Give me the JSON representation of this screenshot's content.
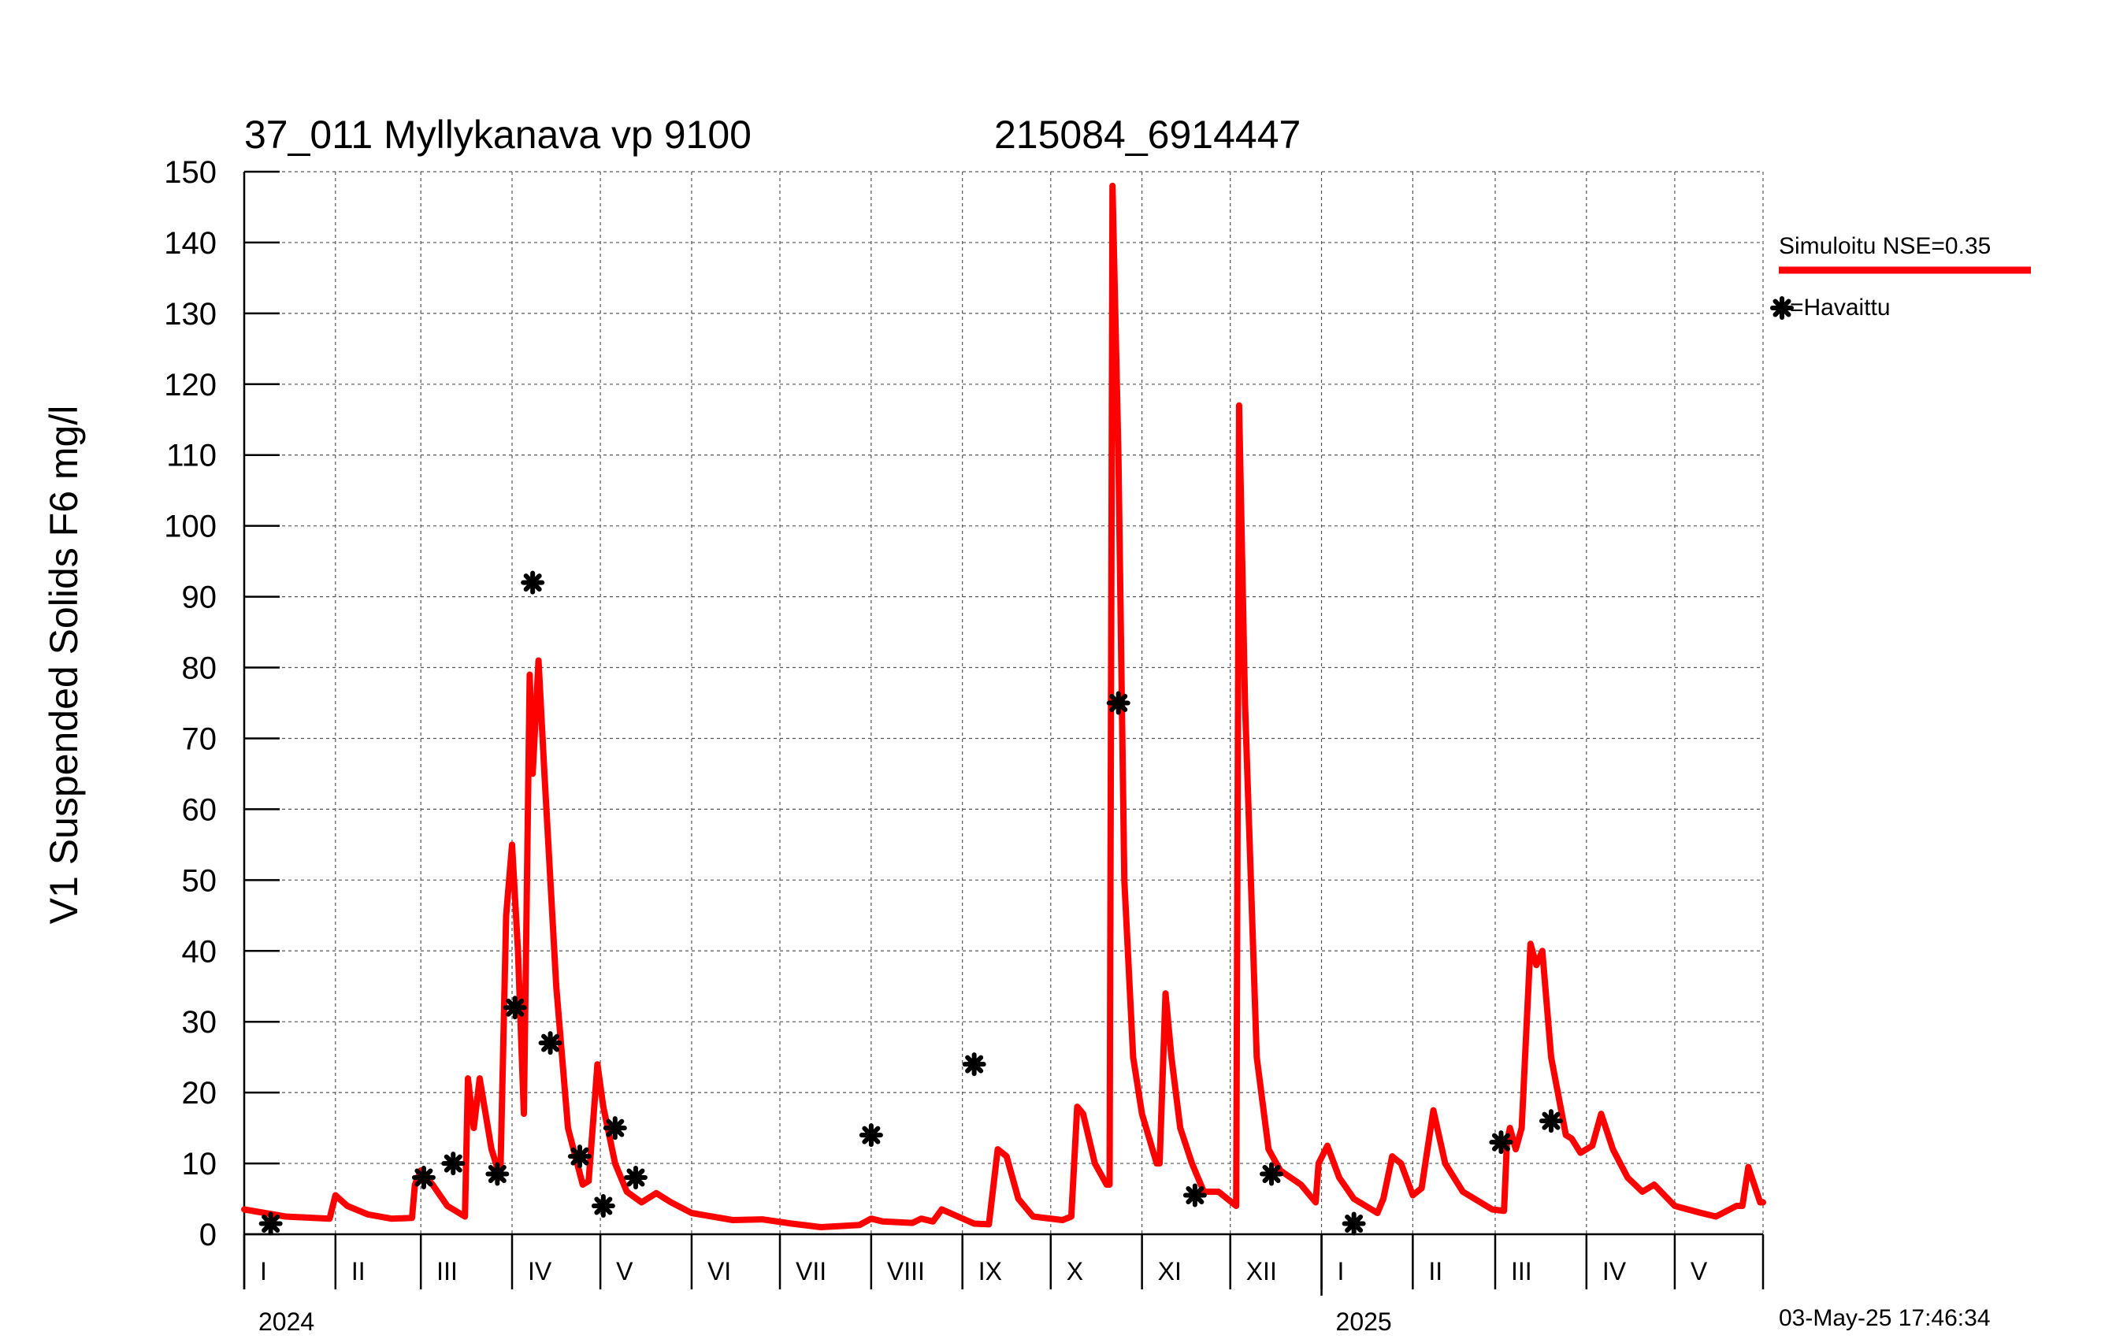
{
  "header": {
    "station": "37_011 Myllykanava vp 9100",
    "coords": "215084_6914447"
  },
  "legend": {
    "simulated_label": "Simuloitu NSE=0.35",
    "observed_label": "=Havaittu",
    "simulated_color": "#ff0000",
    "observed_color": "#000000"
  },
  "timestamp": "03-May-25 17:46:34",
  "chart_data": {
    "type": "line",
    "ylabel": "V1 Suspended Solids F6 mg/l",
    "ylim": [
      0,
      150
    ],
    "yticks": [
      "0",
      "10",
      "20",
      "30",
      "40",
      "50",
      "60",
      "70",
      "80",
      "90",
      "100",
      "110",
      "120",
      "130",
      "140",
      "150"
    ],
    "xlim": [
      "2024-01-01",
      "2025-05-31"
    ],
    "months": [
      {
        "label": "I",
        "start": "2024-01-01"
      },
      {
        "label": "II",
        "start": "2024-02-01"
      },
      {
        "label": "III",
        "start": "2024-03-01"
      },
      {
        "label": "IV",
        "start": "2024-04-01"
      },
      {
        "label": "V",
        "start": "2024-05-01"
      },
      {
        "label": "VI",
        "start": "2024-06-01"
      },
      {
        "label": "VII",
        "start": "2024-07-01"
      },
      {
        "label": "VIII",
        "start": "2024-08-01"
      },
      {
        "label": "IX",
        "start": "2024-09-01"
      },
      {
        "label": "X",
        "start": "2024-10-01"
      },
      {
        "label": "XI",
        "start": "2024-11-01"
      },
      {
        "label": "XII",
        "start": "2024-12-01"
      },
      {
        "label": "I",
        "start": "2025-01-01"
      },
      {
        "label": "II",
        "start": "2025-02-01"
      },
      {
        "label": "III",
        "start": "2025-03-01"
      },
      {
        "label": "IV",
        "start": "2025-04-01"
      },
      {
        "label": "V",
        "start": "2025-05-01"
      }
    ],
    "years": [
      {
        "label": "2024",
        "start": "2024-01-01"
      },
      {
        "label": "2025",
        "start": "2025-01-01"
      }
    ],
    "grid": true,
    "series": [
      {
        "name": "Simuloitu NSE=0.35",
        "color": "#ff0000",
        "points": [
          [
            "2024-01-01",
            3.5
          ],
          [
            "2024-01-15",
            2.5
          ],
          [
            "2024-01-30",
            2.2
          ],
          [
            "2024-02-01",
            5.5
          ],
          [
            "2024-02-05",
            4
          ],
          [
            "2024-02-12",
            2.8
          ],
          [
            "2024-02-20",
            2.2
          ],
          [
            "2024-02-27",
            2.3
          ],
          [
            "2024-02-28",
            7
          ],
          [
            "2024-03-01",
            9
          ],
          [
            "2024-03-05",
            7
          ],
          [
            "2024-03-10",
            4
          ],
          [
            "2024-03-16",
            2.5
          ],
          [
            "2024-03-17",
            22
          ],
          [
            "2024-03-19",
            15
          ],
          [
            "2024-03-21",
            22
          ],
          [
            "2024-03-25",
            12
          ],
          [
            "2024-03-28",
            8
          ],
          [
            "2024-03-30",
            45
          ],
          [
            "2024-04-01",
            55
          ],
          [
            "2024-04-03",
            40
          ],
          [
            "2024-04-05",
            17
          ],
          [
            "2024-04-07",
            79
          ],
          [
            "2024-04-08",
            65
          ],
          [
            "2024-04-10",
            81
          ],
          [
            "2024-04-12",
            65
          ],
          [
            "2024-04-16",
            35
          ],
          [
            "2024-04-20",
            15
          ],
          [
            "2024-04-25",
            7
          ],
          [
            "2024-04-27",
            7.5
          ],
          [
            "2024-04-30",
            24
          ],
          [
            "2024-05-02",
            18
          ],
          [
            "2024-05-06",
            10
          ],
          [
            "2024-05-10",
            6
          ],
          [
            "2024-05-15",
            4.5
          ],
          [
            "2024-05-20",
            5.8
          ],
          [
            "2024-05-25",
            4.5
          ],
          [
            "2024-06-01",
            3
          ],
          [
            "2024-06-15",
            2
          ],
          [
            "2024-06-25",
            2.1
          ],
          [
            "2024-07-05",
            1.5
          ],
          [
            "2024-07-15",
            1
          ],
          [
            "2024-07-28",
            1.3
          ],
          [
            "2024-08-01",
            2.2
          ],
          [
            "2024-08-05",
            1.8
          ],
          [
            "2024-08-15",
            1.6
          ],
          [
            "2024-08-18",
            2.2
          ],
          [
            "2024-08-22",
            1.8
          ],
          [
            "2024-08-25",
            3.5
          ],
          [
            "2024-09-05",
            1.5
          ],
          [
            "2024-09-10",
            1.4
          ],
          [
            "2024-09-13",
            12
          ],
          [
            "2024-09-16",
            11
          ],
          [
            "2024-09-20",
            5
          ],
          [
            "2024-09-25",
            2.5
          ],
          [
            "2024-10-05",
            2
          ],
          [
            "2024-10-08",
            2.5
          ],
          [
            "2024-10-10",
            18
          ],
          [
            "2024-10-12",
            17
          ],
          [
            "2024-10-16",
            10
          ],
          [
            "2024-10-20",
            7
          ],
          [
            "2024-10-21",
            7
          ],
          [
            "2024-10-22",
            148
          ],
          [
            "2024-10-24",
            110
          ],
          [
            "2024-10-26",
            50
          ],
          [
            "2024-10-29",
            25
          ],
          [
            "2024-11-01",
            17
          ],
          [
            "2024-11-06",
            10
          ],
          [
            "2024-11-07",
            10
          ],
          [
            "2024-11-09",
            34
          ],
          [
            "2024-11-11",
            25
          ],
          [
            "2024-11-14",
            15
          ],
          [
            "2024-11-18",
            10
          ],
          [
            "2024-11-22",
            6
          ],
          [
            "2024-11-27",
            6
          ],
          [
            "2024-12-03",
            4
          ],
          [
            "2024-12-04",
            117
          ],
          [
            "2024-12-06",
            75
          ],
          [
            "2024-12-10",
            25
          ],
          [
            "2024-12-14",
            12
          ],
          [
            "2024-12-18",
            9
          ],
          [
            "2024-12-25",
            7
          ],
          [
            "2024-12-30",
            4.5
          ],
          [
            "2024-12-31",
            10
          ],
          [
            "2025-01-03",
            12.5
          ],
          [
            "2025-01-07",
            8
          ],
          [
            "2025-01-12",
            5
          ],
          [
            "2025-01-20",
            3
          ],
          [
            "2025-01-22",
            5
          ],
          [
            "2025-01-25",
            11
          ],
          [
            "2025-01-28",
            10
          ],
          [
            "2025-02-01",
            5.5
          ],
          [
            "2025-02-04",
            6.5
          ],
          [
            "2025-02-06",
            12
          ],
          [
            "2025-02-08",
            17.5
          ],
          [
            "2025-02-12",
            10
          ],
          [
            "2025-02-18",
            6
          ],
          [
            "2025-02-28",
            3.5
          ],
          [
            "2025-03-04",
            3.3
          ],
          [
            "2025-03-05",
            13
          ],
          [
            "2025-03-06",
            15
          ],
          [
            "2025-03-08",
            12
          ],
          [
            "2025-03-10",
            15
          ],
          [
            "2025-03-13",
            41
          ],
          [
            "2025-03-15",
            38
          ],
          [
            "2025-03-17",
            40
          ],
          [
            "2025-03-20",
            25
          ],
          [
            "2025-03-25",
            14
          ],
          [
            "2025-03-27",
            13.5
          ],
          [
            "2025-03-30",
            11.5
          ],
          [
            "2025-04-03",
            12.5
          ],
          [
            "2025-04-06",
            17
          ],
          [
            "2025-04-10",
            12
          ],
          [
            "2025-04-15",
            8
          ],
          [
            "2025-04-20",
            6
          ],
          [
            "2025-04-24",
            7
          ],
          [
            "2025-05-01",
            4
          ],
          [
            "2025-05-10",
            3
          ],
          [
            "2025-05-15",
            2.5
          ],
          [
            "2025-05-22",
            4
          ],
          [
            "2025-05-24",
            4
          ],
          [
            "2025-05-26",
            9.5
          ],
          [
            "2025-05-28",
            7
          ],
          [
            "2025-05-30",
            4.5
          ],
          [
            "2025-05-31",
            4.5
          ]
        ]
      },
      {
        "name": "=Havaittu",
        "color": "#000000",
        "points": [
          [
            "2024-01-10",
            1.5
          ],
          [
            "2024-03-02",
            8
          ],
          [
            "2024-03-12",
            10
          ],
          [
            "2024-03-27",
            8.5
          ],
          [
            "2024-04-02",
            32
          ],
          [
            "2024-04-08",
            92
          ],
          [
            "2024-04-14",
            27
          ],
          [
            "2024-04-24",
            11
          ],
          [
            "2024-05-02",
            4
          ],
          [
            "2024-05-06",
            15
          ],
          [
            "2024-05-13",
            8
          ],
          [
            "2024-08-01",
            14
          ],
          [
            "2024-09-05",
            24
          ],
          [
            "2024-10-24",
            75
          ],
          [
            "2024-11-19",
            5.5
          ],
          [
            "2024-12-15",
            8.5
          ],
          [
            "2025-01-12",
            1.5
          ],
          [
            "2025-03-03",
            13
          ],
          [
            "2025-03-20",
            16
          ]
        ]
      }
    ]
  }
}
